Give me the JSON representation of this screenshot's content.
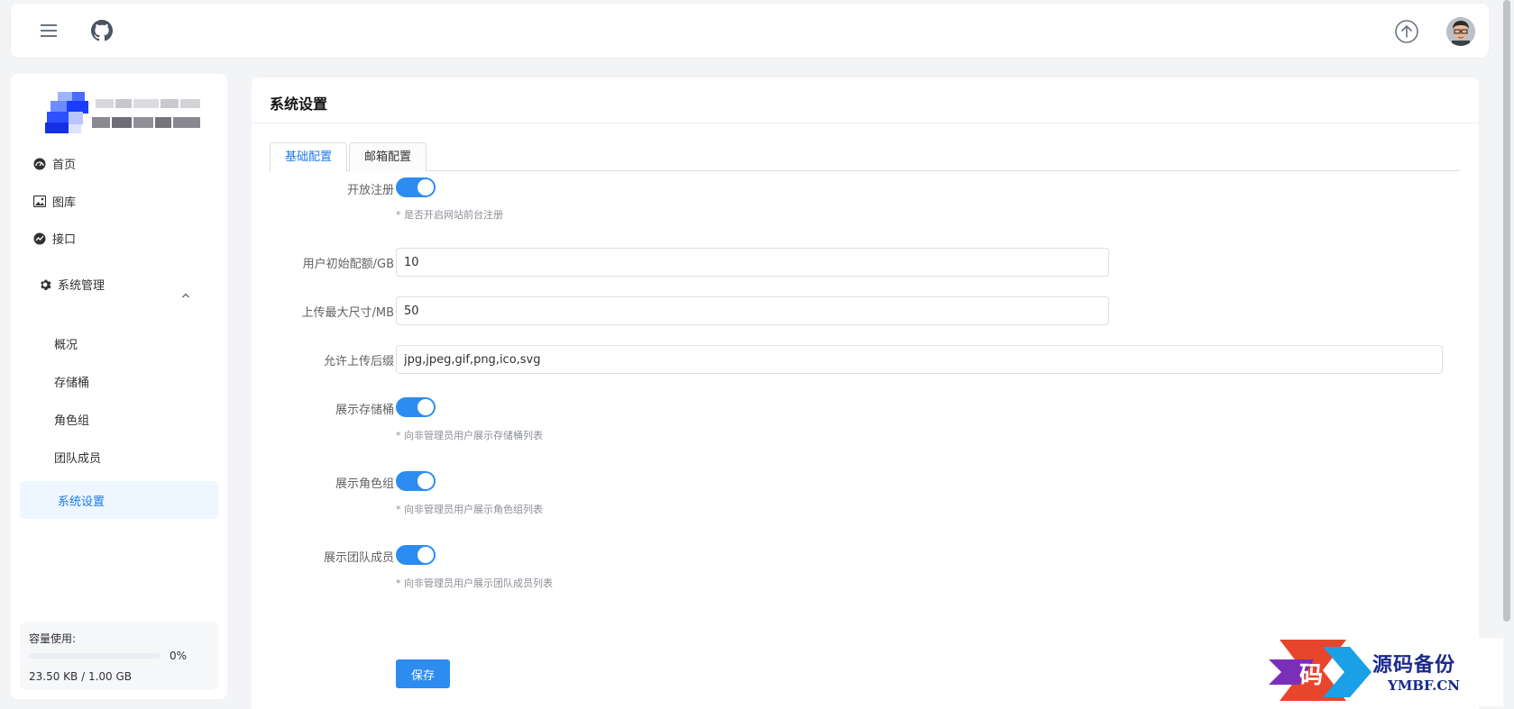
{
  "topbar": {
    "icons": {
      "menu": "menu-icon",
      "github": "github-icon",
      "upload": "upload-icon"
    }
  },
  "sidebar": {
    "items": [
      {
        "label": "首页",
        "icon": "dashboard-icon"
      },
      {
        "label": "图库",
        "icon": "image-icon"
      },
      {
        "label": "接口",
        "icon": "api-icon"
      }
    ],
    "group": {
      "label": "系统管理",
      "icon": "gear-icon",
      "expanded": true
    },
    "subitems": [
      {
        "label": "概况"
      },
      {
        "label": "存储桶"
      },
      {
        "label": "角色组"
      },
      {
        "label": "团队成员"
      },
      {
        "label": "系统设置",
        "active": true
      }
    ],
    "usage": {
      "label": "容量使用:",
      "percent_text": "0%",
      "percent": 0,
      "size_text": "23.50 KB / 1.00 GB"
    }
  },
  "main": {
    "title": "系统设置",
    "tabs": [
      {
        "label": "基础配置",
        "active": true
      },
      {
        "label": "邮箱配置",
        "active": false
      }
    ],
    "form": {
      "open_register": {
        "label": "开放注册",
        "enabled": true,
        "hint": "* 是否开启网站前台注册"
      },
      "initial_quota": {
        "label": "用户初始配额/GB",
        "value": "10"
      },
      "max_upload": {
        "label": "上传最大尺寸/MB",
        "value": "50"
      },
      "allowed_ext": {
        "label": "允许上传后缀",
        "value": "jpg,jpeg,gif,png,ico,svg"
      },
      "show_buckets": {
        "label": "展示存储桶",
        "enabled": true,
        "hint": "* 向非管理员用户展示存储桶列表"
      },
      "show_roles": {
        "label": "展示角色组",
        "enabled": true,
        "hint": "* 向非管理员用户展示角色组列表"
      },
      "show_team": {
        "label": "展示团队成员",
        "enabled": true,
        "hint": "* 向非管理员用户展示团队成员列表"
      },
      "save_label": "保存"
    }
  },
  "watermark": {
    "badge": "码",
    "text": "源码备份",
    "url": "YMBF.CN"
  },
  "colors": {
    "primary": "#2d8cf0",
    "active_bg": "#eef6ff",
    "active_text": "#1d7bea"
  }
}
